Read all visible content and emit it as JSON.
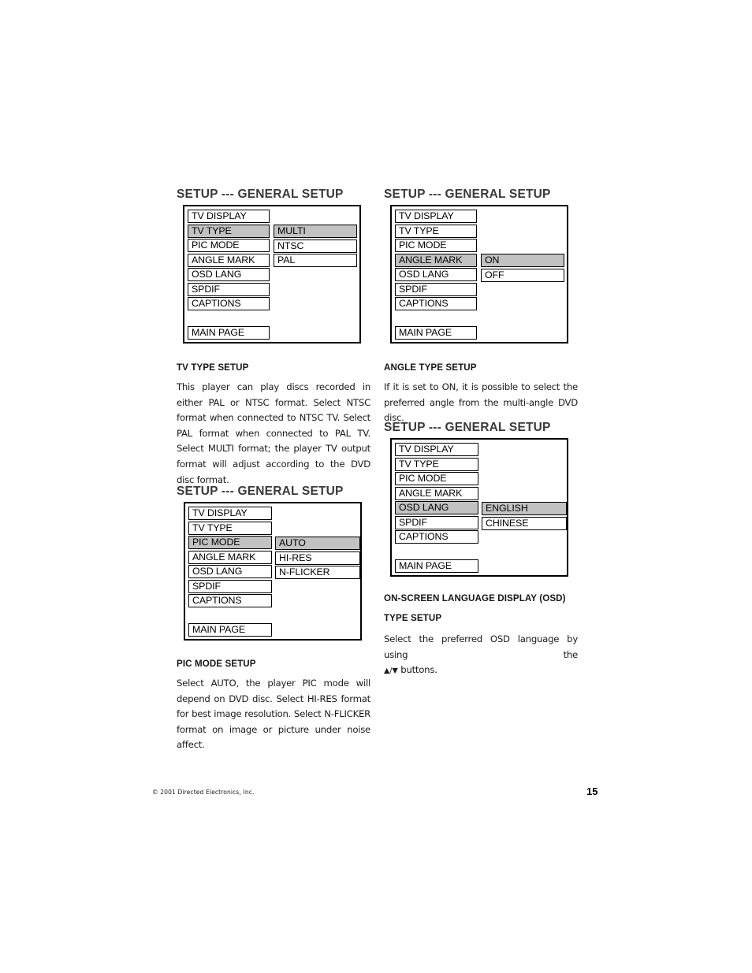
{
  "document": {
    "page_number": "15",
    "copyright": "© 2001 Directed Electronics, Inc."
  },
  "panels": {
    "tv_type": {
      "heading": "SETUP --- GENERAL SETUP",
      "menu_items": [
        "TV DISPLAY",
        "TV TYPE",
        "PIC MODE",
        "ANGLE MARK",
        "OSD LANG",
        "SPDIF",
        "CAPTIONS"
      ],
      "selected_menu_item": "TV TYPE",
      "main_page_label": "MAIN PAGE",
      "options": [
        "MULTI",
        "NTSC",
        "PAL"
      ],
      "selected_option": "MULTI"
    },
    "angle_mark": {
      "heading": "SETUP --- GENERAL SETUP",
      "menu_items": [
        "TV DISPLAY",
        "TV TYPE",
        "PIC MODE",
        "ANGLE MARK",
        "OSD LANG",
        "SPDIF",
        "CAPTIONS"
      ],
      "selected_menu_item": "ANGLE MARK",
      "main_page_label": "MAIN PAGE",
      "options": [
        "ON",
        "OFF"
      ],
      "selected_option": "ON"
    },
    "pic_mode": {
      "heading": "SETUP --- GENERAL SETUP",
      "menu_items": [
        "TV DISPLAY",
        "TV TYPE",
        "PIC MODE",
        "ANGLE MARK",
        "OSD LANG",
        "SPDIF",
        "CAPTIONS"
      ],
      "selected_menu_item": "PIC MODE",
      "main_page_label": "MAIN PAGE",
      "options": [
        "AUTO",
        "HI-RES",
        "N-FLICKER"
      ],
      "selected_option": "AUTO"
    },
    "osd_lang": {
      "heading": "SETUP --- GENERAL SETUP",
      "menu_items": [
        "TV DISPLAY",
        "TV TYPE",
        "PIC MODE",
        "ANGLE MARK",
        "OSD LANG",
        "SPDIF",
        "CAPTIONS"
      ],
      "selected_menu_item": "OSD LANG",
      "main_page_label": "MAIN PAGE",
      "options": [
        "ENGLISH",
        "CHINESE"
      ],
      "selected_option": "ENGLISH"
    }
  },
  "sections": {
    "tv_type": {
      "title": "TV TYPE SETUP",
      "body": "This player can play discs recorded in either PAL or NTSC format. Select NTSC format when connected to NTSC TV. Select PAL format when connected to PAL TV. Select MULTI format; the player TV output format will adjust according to the DVD disc format."
    },
    "angle_type": {
      "title": "ANGLE TYPE SETUP",
      "body": "If it is set to ON, it is possible to select the preferred angle from the multi-angle DVD disc."
    },
    "pic_mode": {
      "title": "PIC MODE SETUP",
      "body": "Select AUTO, the player PIC mode will depend on DVD disc. Select HI-RES format for best image resolution. Select N-FLICKER format on image or picture under noise affect."
    },
    "osd_lang": {
      "title_line1": "ON-SCREEN LANGUAGE DISPLAY (OSD)",
      "title_line2": "TYPE SETUP",
      "body_prefix": "Select the preferred OSD language by using the",
      "body_arrows": "▲/▼",
      "body_suffix": " buttons."
    }
  },
  "colors": {
    "highlight": "#c2c2c2",
    "border": "#000000",
    "heading": "#3a3a3a",
    "text": "#1a1a1a"
  }
}
